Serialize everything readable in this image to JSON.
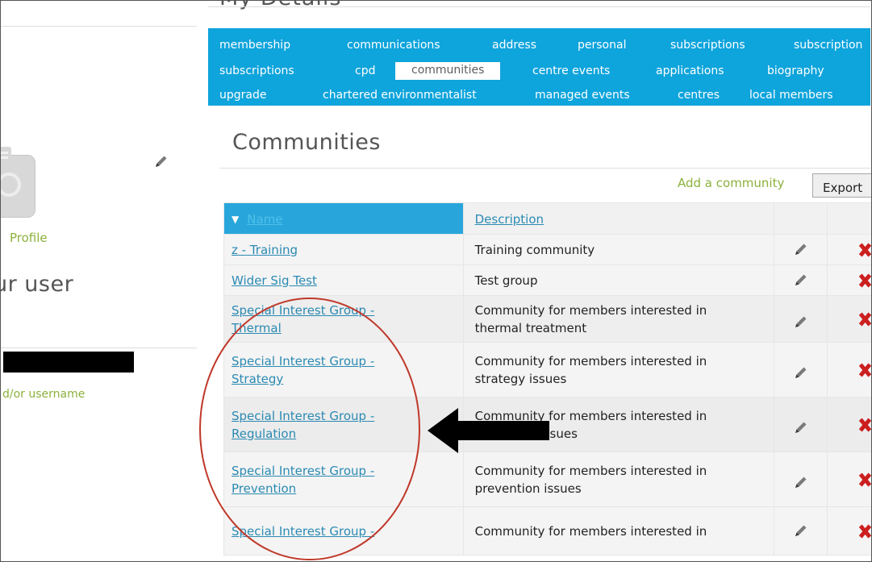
{
  "page": {
    "title": "My Details"
  },
  "sidebar": {
    "profile_link": "Profile",
    "user_heading": "ur user",
    "username_hint": "d/or username"
  },
  "nav": {
    "tabs": [
      {
        "label": "membership"
      },
      {
        "label": "communications"
      },
      {
        "label": "address"
      },
      {
        "label": "personal"
      },
      {
        "label": "subscriptions"
      },
      {
        "label": "subscription"
      },
      {
        "label": "subscriptions"
      },
      {
        "label": "cpd"
      },
      {
        "label": "communities",
        "active": true
      },
      {
        "label": "centre events"
      },
      {
        "label": "applications"
      },
      {
        "label": "biography"
      },
      {
        "label": "upgrade"
      },
      {
        "label": "chartered environmentalist"
      },
      {
        "label": "managed events"
      },
      {
        "label": "centres"
      },
      {
        "label": "local members"
      }
    ]
  },
  "section": {
    "title": "Communities",
    "add_link": "Add a community",
    "export_label": "Export"
  },
  "table": {
    "headers": {
      "name": "Name",
      "description": "Description"
    },
    "rows": [
      {
        "name": [
          "z - Training"
        ],
        "description": [
          "Training community"
        ]
      },
      {
        "name": [
          "Wider Sig Test"
        ],
        "description": [
          "Test group"
        ]
      },
      {
        "name": [
          "Special Interest Group -",
          "Thermal"
        ],
        "description": [
          "Community for members interested in",
          "thermal treatment"
        ]
      },
      {
        "name": [
          "Special Interest Group -",
          "Strategy"
        ],
        "description": [
          "Community for members interested in",
          "strategy issues"
        ]
      },
      {
        "name": [
          "Special Interest Group -",
          "Regulation"
        ],
        "description": [
          "Community for members interested in",
          "regulation issues"
        ]
      },
      {
        "name": [
          "Special Interest Group -",
          "Prevention"
        ],
        "description": [
          "Community for members interested in",
          "prevention issues"
        ]
      },
      {
        "name": [
          "Special Interest Group -"
        ],
        "description": [
          "Community for members interested in"
        ]
      }
    ]
  },
  "colors": {
    "nav_bg": "#0ea4dc",
    "header_sort_bg": "#28a6dc",
    "link": "#2b8ab3",
    "green_link": "#8cb13c",
    "delete": "#cc1f1f",
    "annotation_circle": "#c0392b"
  },
  "icons": {
    "edit": "pencil-icon",
    "delete": "delete-x-icon",
    "camera": "camera-icon",
    "sort": "sort-arrow-icon"
  }
}
